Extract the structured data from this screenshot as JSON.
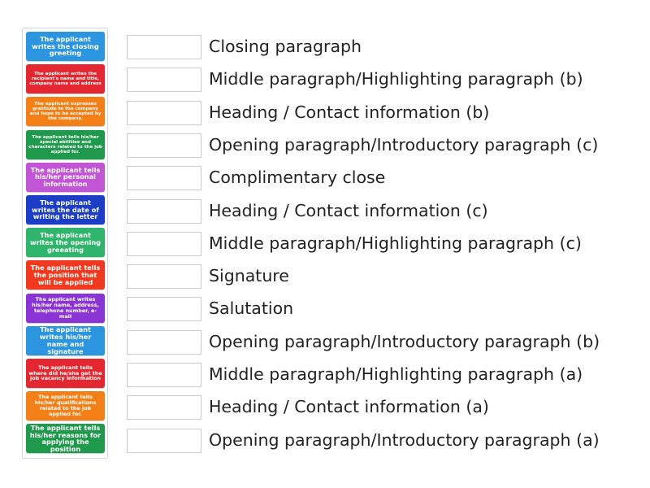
{
  "cards": [
    {
      "text": "The applicant writes the closing greeting",
      "color": "#2b95e0",
      "size": "l"
    },
    {
      "text": "The applicant writes the recipient's name and title, company name and address",
      "color": "#e3262f",
      "size": "s"
    },
    {
      "text": "The applicant expresses gratitude to the company and hope to be accepted by the company.",
      "color": "#f47f16",
      "size": "s"
    },
    {
      "text": "The applicant tells his/her special abilities and characters related to the job applied for.",
      "color": "#1f9a4c",
      "size": "s"
    },
    {
      "text": "The applicant tells his/her personal information",
      "color": "#c155d6",
      "size": "l"
    },
    {
      "text": "The applicant writes the date of writing the letter",
      "color": "#1c3ec6",
      "size": "l"
    },
    {
      "text": "The applicant writes the opening greeating",
      "color": "#2fb56b",
      "size": "l"
    },
    {
      "text": "The applicant tells the position that will be applied",
      "color": "#f0391e",
      "size": "l"
    },
    {
      "text": "The applicant writes his/her name, address, telephone number, e-mail",
      "color": "#8a34d6",
      "size": "m"
    },
    {
      "text": "The applicant writes his/her name and signature",
      "color": "#2b95e0",
      "size": "l"
    },
    {
      "text": "The applicant tells where did he/she get the job vacancy information",
      "color": "#e3262f",
      "size": "m"
    },
    {
      "text": "The applicant tells his/her qualifications related to the job applied for.",
      "color": "#f47f16",
      "size": "m"
    },
    {
      "text": "The applicant tells his/her reasons for applying the position",
      "color": "#1f9a4c",
      "size": "l"
    }
  ],
  "slots": [
    {
      "label": "Closing paragraph"
    },
    {
      "label": "Middle paragraph/Highlighting paragraph (b)"
    },
    {
      "label": "Heading / Contact information (b)"
    },
    {
      "label": "Opening paragraph/Introductory paragraph (c)"
    },
    {
      "label": "Complimentary close"
    },
    {
      "label": "Heading / Contact information (c)"
    },
    {
      "label": "Middle paragraph/Highlighting paragraph (c)"
    },
    {
      "label": "Signature"
    },
    {
      "label": "Salutation"
    },
    {
      "label": "Opening paragraph/Introductory paragraph (b)"
    },
    {
      "label": "Middle paragraph/Highlighting paragraph (a)"
    },
    {
      "label": "Heading / Contact information (a)"
    },
    {
      "label": "Opening paragraph/Introductory paragraph (a)"
    }
  ]
}
